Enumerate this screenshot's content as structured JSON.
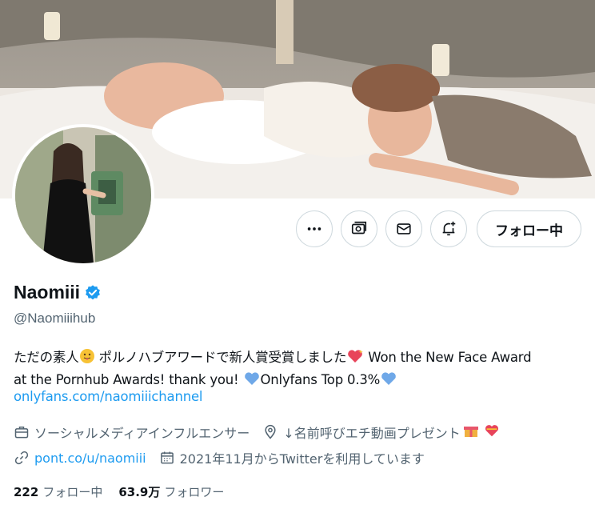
{
  "profile": {
    "display_name": "Naomiii",
    "handle": "@Naomiiihub",
    "verified": true,
    "bio_line1_a": "ただの素人",
    "bio_line1_b": " ポルノハブアワードで新人賞受賞しました",
    "bio_line1_c": " Won the New Face Award",
    "bio_line2_a": "at the Pornhub Awards! thank you! ",
    "bio_line2_b": "Onlyfans Top 0.3%",
    "bio_link": "onlyfans.com/naomiiichannel",
    "category": "ソーシャルメディアインフルエンサー",
    "location": "↓名前呼びエチ動画プレゼント",
    "website": "pont.co/u/naomiii",
    "joined": "2021年11月からTwitterを利用しています"
  },
  "actions": {
    "more_icon": "more-icon",
    "tip_icon": "tip-jar-icon",
    "message_icon": "envelope-icon",
    "notify_icon": "bell-plus-icon",
    "follow_label": "フォロー中"
  },
  "stats": {
    "following_count": "222",
    "following_label": "フォロー中",
    "followers_count": "63.9万",
    "followers_label": "フォロワー"
  },
  "colors": {
    "accent": "#1d9bf0",
    "secondary_text": "#536471",
    "border": "#cfd9de"
  }
}
